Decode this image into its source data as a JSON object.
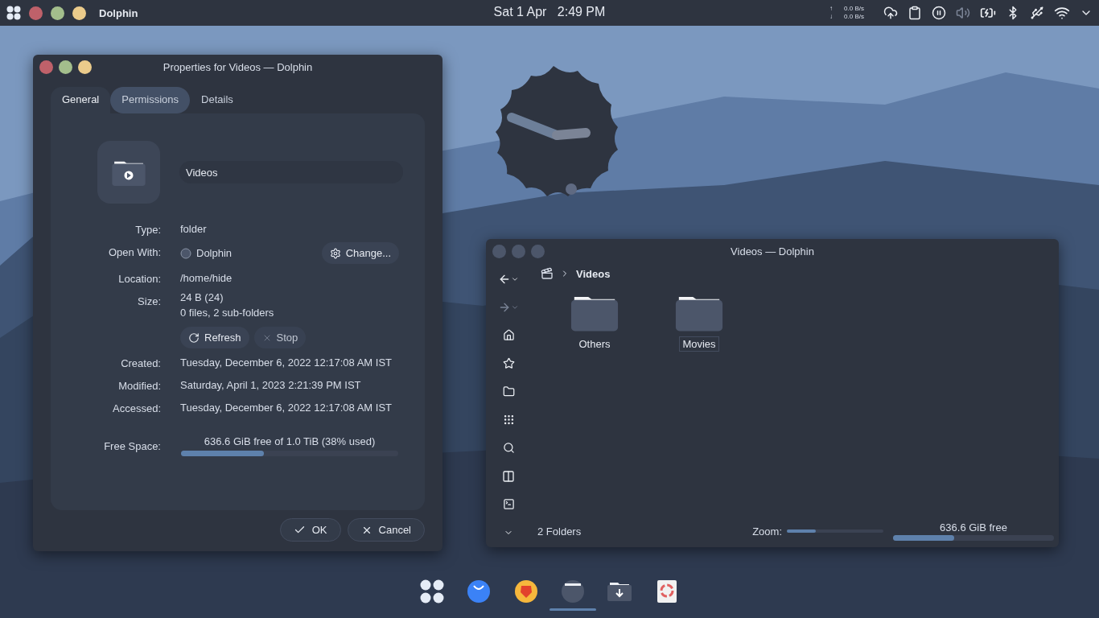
{
  "top_bar": {
    "app_name": "Dolphin",
    "date": "Sat 1 Apr",
    "time": "2:49 PM",
    "net": [
      {
        "arrow": "↑",
        "rate": "0.0 B/s"
      },
      {
        "arrow": "↓",
        "rate": "0.0 B/s"
      }
    ]
  },
  "properties_window": {
    "title": "Properties for Videos — Dolphin",
    "tabs": [
      {
        "label": "General",
        "selected": true,
        "hovered": false
      },
      {
        "label": "Permissions",
        "selected": false,
        "hovered": true
      },
      {
        "label": "Details",
        "selected": false,
        "hovered": false
      }
    ],
    "name_value": "Videos",
    "fields": [
      {
        "kind": "text",
        "label": "Type:",
        "value": "folder"
      },
      {
        "kind": "app",
        "label": "Open With:",
        "value": "Dolphin",
        "button": "Change..."
      },
      {
        "kind": "text",
        "label": "Location:",
        "value": "/home/hide"
      },
      {
        "kind": "size",
        "label": "Size:",
        "value": "24 B (24)",
        "detail": "0 files, 2 sub-folders",
        "buttons": [
          {
            "label": "Refresh",
            "disabled": false
          },
          {
            "label": "Stop",
            "disabled": true
          }
        ]
      },
      {
        "kind": "text",
        "label": "Created:",
        "value": "Tuesday, December 6, 2022 12:17:08 AM IST"
      },
      {
        "kind": "text",
        "label": "Modified:",
        "value": "Saturday, April 1, 2023 2:21:39 PM IST"
      },
      {
        "kind": "text",
        "label": "Accessed:",
        "value": "Tuesday, December 6, 2022 12:17:08 AM IST"
      },
      {
        "kind": "meter",
        "label": "Free Space:",
        "value": "636.6 GiB free of 1.0 TiB (38% used)",
        "level": 0.38
      }
    ],
    "buttons": [
      {
        "kind": "ok",
        "label": "OK"
      },
      {
        "kind": "cancel",
        "label": "Cancel"
      }
    ]
  },
  "file_window": {
    "title": "Videos — Dolphin",
    "breadcrumb": "Videos",
    "items": [
      {
        "name": "Others",
        "selected": false
      },
      {
        "name": "Movies",
        "selected": true
      }
    ],
    "status": "2 Folders",
    "zoom_label": "Zoom:",
    "zoom": {
      "level": 0.3
    },
    "free": {
      "text": "636.6 GiB free",
      "level": 0.38
    }
  },
  "dock": [
    {
      "kind": "launcher",
      "running": false
    },
    {
      "kind": "store",
      "running": false
    },
    {
      "kind": "browser",
      "running": false
    },
    {
      "kind": "files",
      "running": true
    },
    {
      "kind": "downloads",
      "running": false
    },
    {
      "kind": "trash",
      "running": false
    }
  ]
}
